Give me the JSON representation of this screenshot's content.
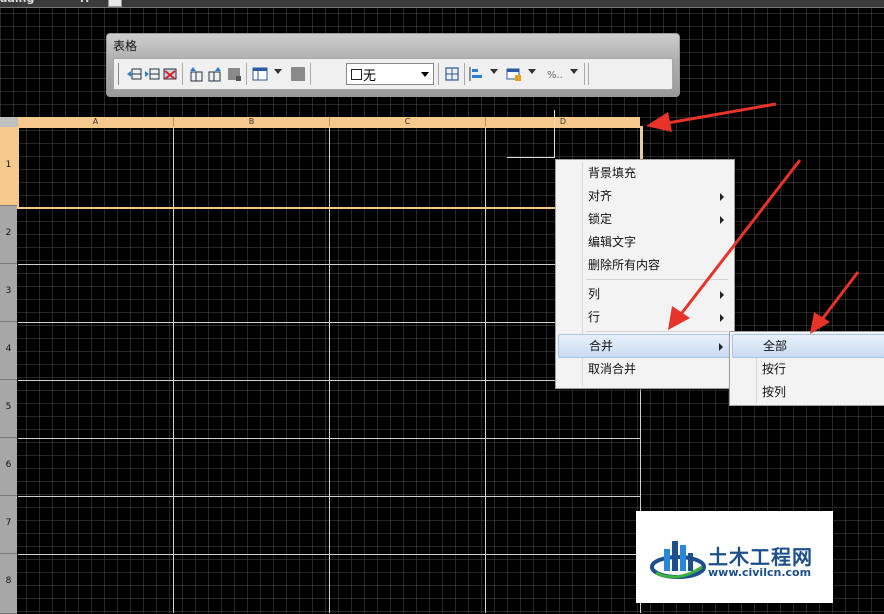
{
  "window": {
    "tab_text": "aaing",
    "tab_marker": "rr"
  },
  "toolbar": {
    "title": "表格",
    "icons": [
      "insert-row-above-icon",
      "insert-row-below-icon",
      "delete-row-icon",
      "insert-column-left-icon",
      "insert-column-right-icon",
      "delete-column-icon",
      "merge-cells-icon",
      "cell-style-icon",
      "border-icon",
      "align-icon",
      "format-icon",
      "data-format-icon"
    ],
    "border_select": {
      "value": "无"
    }
  },
  "columns": [
    "A",
    "B",
    "C",
    "D"
  ],
  "rows": [
    "1",
    "2",
    "3",
    "4",
    "5",
    "6",
    "7",
    "8"
  ],
  "context_menu": {
    "items": [
      {
        "label": "背景填充",
        "submenu": false
      },
      {
        "label": "对齐",
        "submenu": true
      },
      {
        "label": "锁定",
        "submenu": true
      },
      {
        "label": "编辑文字",
        "submenu": false
      },
      {
        "label": "删除所有内容",
        "submenu": false
      },
      {
        "label": "列",
        "submenu": true
      },
      {
        "label": "行",
        "submenu": true
      },
      {
        "label": "合并",
        "submenu": true,
        "highlighted": true
      },
      {
        "label": "取消合并",
        "submenu": false
      }
    ]
  },
  "submenu": {
    "items": [
      {
        "label": "全部",
        "highlighted": true
      },
      {
        "label": "按行"
      },
      {
        "label": "按列"
      }
    ]
  },
  "watermark": {
    "name": "土木工程网",
    "url": "www.civilcn.com"
  },
  "colors": {
    "header_highlight": "#f5c98c",
    "arrow": "#e8332a",
    "menu_highlight": "#c9dcf2",
    "logo_blue": "#1c4f8c"
  }
}
